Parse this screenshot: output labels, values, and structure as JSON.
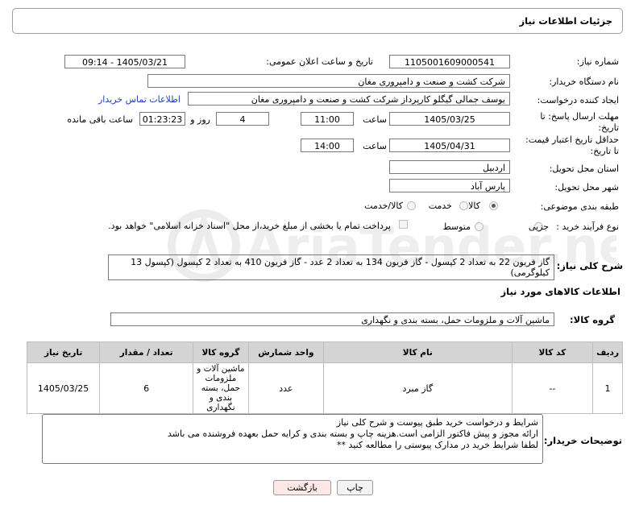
{
  "header": {
    "title": "جزئیات اطلاعات نیاز"
  },
  "form": {
    "need_number": {
      "label": "شماره نیاز:",
      "value": "1105001609000541"
    },
    "announce_datetime": {
      "label": "تاریخ و ساعت اعلان عمومی:",
      "value": "1405/03/21 - 09:14"
    },
    "buyer_org": {
      "label": "نام دستگاه خریدار:",
      "value": "شرکت کشت و صنعت و دامپروری مغان"
    },
    "requester": {
      "label": "ایجاد کننده درخواست:",
      "value": "یوسف جمالی گیگلو کارپرداز شرکت کشت و صنعت و دامپروری مغان",
      "contact_link": "اطلاعات تماس خریدار"
    },
    "send_deadline": {
      "label_line1": "مهلت ارسال پاسخ: تا",
      "label_line2": "تاریخ:",
      "date": "1405/03/25",
      "time_label": "ساعت",
      "time": "11:00",
      "days": "4",
      "days_label": "روز و",
      "remaining": "01:23:23",
      "remaining_label": "ساعت باقی مانده"
    },
    "price_validity": {
      "label_line1": "حداقل تاریخ اعتبار قیمت:",
      "label_line2": "تا تاریخ:",
      "date": "1405/04/31",
      "time_label": "ساعت",
      "time": "14:00"
    },
    "province": {
      "label": "استان محل تحویل:",
      "value": "اردبیل"
    },
    "city": {
      "label": "شهر محل تحویل:",
      "value": "پارس آباد"
    },
    "category": {
      "label": "طبقه بندی موضوعی:",
      "options": [
        "کالا",
        "خدمت",
        "کالا/خدمت"
      ],
      "selected": "کالا"
    },
    "process": {
      "label": "نوع فرآیند خرید :",
      "options": [
        "جزیی",
        "متوسط"
      ],
      "selected": "",
      "payment_note": "پرداخت تمام یا بخشی از مبلغ خرید،از محل \"اسناد خزانه اسلامی\" خواهد بود."
    }
  },
  "description": {
    "label": "شرح کلی نیاز:",
    "text": "گاز فریون 22 به تعداد 2 کپسول - گاز فریون 134  به تعداد 2 عدد - گاز فریون 410  به تعداد 2 کپسول  (کپسول 13 کیلوگرمی)"
  },
  "goods_section": {
    "title": "اطلاعات کالاهای مورد نیاز",
    "group_label": "گروه کالا:",
    "group_value": "ماشین آلات و ملزومات حمل، بسته بندی و نگهداری"
  },
  "table": {
    "headers": [
      "ردیف",
      "کد کالا",
      "نام کالا",
      "واحد شمارش",
      "گروه کالا",
      "تعداد / مقدار",
      "تاریخ نیاز"
    ],
    "rows": [
      {
        "row": "1",
        "code": "--",
        "name": "گاز مبرد",
        "unit": "عدد",
        "group": "ماشین آلات و ملزومات حمل، بسته بندی و نگهداری",
        "qty": "6",
        "date": "1405/03/25"
      }
    ]
  },
  "buyer_notes": {
    "label": "توضیحات خریدار:",
    "lines": [
      "شرایط و درخواست خرید طبق پیوست و شرح کلی نیاز",
      "ارائه مجوز و پیش فاکتور الزامی است.هزینه چاپ و بسته بندی و کرایه حمل بعهده فروشنده می باشد",
      "لطفا شرایط خرید در مدارک پیوستی را مطالعه کنید **"
    ]
  },
  "buttons": {
    "print": "چاپ",
    "back": "بازگشت"
  },
  "colors": {
    "header_border": "#9aa0a6",
    "link": "#1a3fb5",
    "back_button_bg": "#fde8e8",
    "table_header_bg": "#d4d4d4",
    "watermark": "#d9d9d9"
  },
  "watermark": {
    "text": "AriaTender.net"
  }
}
